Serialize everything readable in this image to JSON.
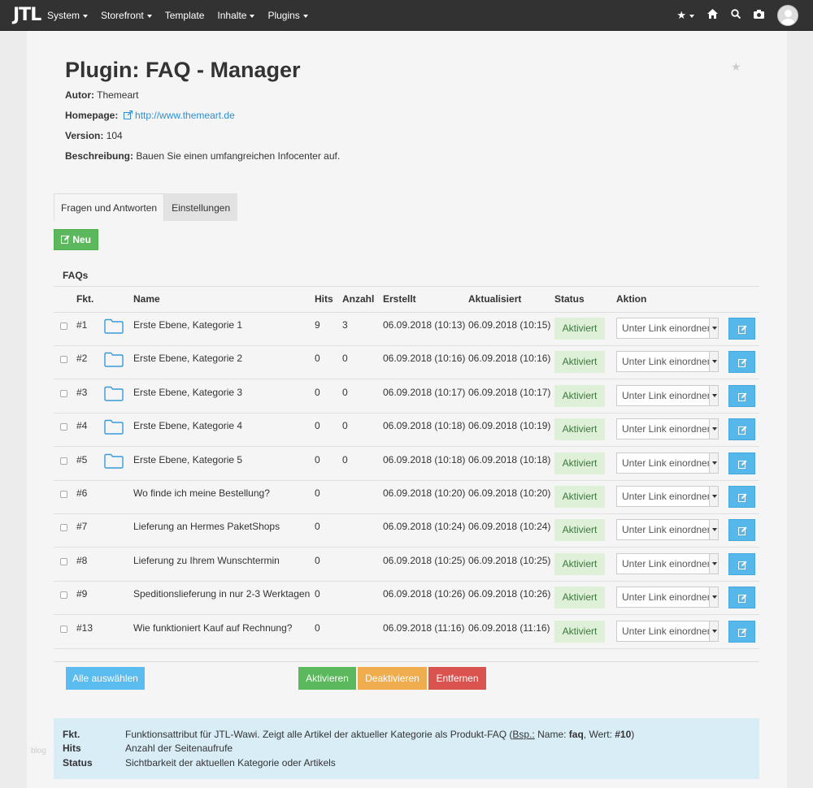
{
  "navbar": {
    "brand": "JTL",
    "items": [
      {
        "label": "System",
        "dropdown": true
      },
      {
        "label": "Storefront",
        "dropdown": true
      },
      {
        "label": "Template",
        "dropdown": false
      },
      {
        "label": "Inhalte",
        "dropdown": true
      },
      {
        "label": "Plugins",
        "dropdown": true
      }
    ],
    "right_icons": [
      "star-icon",
      "home-icon",
      "search-icon",
      "camera-icon",
      "avatar"
    ]
  },
  "header": {
    "title": "Plugin: FAQ - Manager",
    "author_label": "Autor:",
    "author": "Themeart",
    "homepage_label": "Homepage:",
    "homepage": "http://www.themeart.de",
    "version_label": "Version:",
    "version": "104",
    "description_label": "Beschreibung:",
    "description": "Bauen Sie einen umfangreichen Infocenter auf."
  },
  "tabs": [
    "Fragen und Antworten",
    "Einstellungen"
  ],
  "new_button": "Neu",
  "faqs_heading": "FAQs",
  "table": {
    "columns": [
      "Fkt.",
      "Name",
      "Hits",
      "Anzahl",
      "Erstellt",
      "Aktualisiert",
      "Status",
      "Aktion"
    ],
    "rows": [
      {
        "id": "#1",
        "folder": true,
        "name": "Erste Ebene, Kategorie 1",
        "hits": "9",
        "count": "3",
        "created": "06.09.2018 (10:13)",
        "updated": "06.09.2018 (10:15)",
        "status": "Aktiviert",
        "action": "Unter Link einordnen"
      },
      {
        "id": "#2",
        "folder": true,
        "name": "Erste Ebene, Kategorie 2",
        "hits": "0",
        "count": "0",
        "created": "06.09.2018 (10:16)",
        "updated": "06.09.2018 (10:16)",
        "status": "Aktiviert",
        "action": "Unter Link einordnen"
      },
      {
        "id": "#3",
        "folder": true,
        "name": "Erste Ebene, Kategorie 3",
        "hits": "0",
        "count": "0",
        "created": "06.09.2018 (10:17)",
        "updated": "06.09.2018 (10:17)",
        "status": "Aktiviert",
        "action": "Unter Link einordnen"
      },
      {
        "id": "#4",
        "folder": true,
        "name": "Erste Ebene, Kategorie 4",
        "hits": "0",
        "count": "0",
        "created": "06.09.2018 (10:18)",
        "updated": "06.09.2018 (10:19)",
        "status": "Aktiviert",
        "action": "Unter Link einordnen"
      },
      {
        "id": "#5",
        "folder": true,
        "name": "Erste Ebene, Kategorie 5",
        "hits": "0",
        "count": "0",
        "created": "06.09.2018 (10:18)",
        "updated": "06.09.2018 (10:18)",
        "status": "Aktiviert",
        "action": "Unter Link einordnen"
      },
      {
        "id": "#6",
        "folder": false,
        "name": "Wo finde ich meine Bestellung?",
        "hits": "0",
        "count": "",
        "created": "06.09.2018 (10:20)",
        "updated": "06.09.2018 (10:20)",
        "status": "Aktiviert",
        "action": "Unter Link einordnen"
      },
      {
        "id": "#7",
        "folder": false,
        "name": "Lieferung an Hermes PaketShops",
        "hits": "0",
        "count": "",
        "created": "06.09.2018 (10:24)",
        "updated": "06.09.2018 (10:24)",
        "status": "Aktiviert",
        "action": "Unter Link einordnen"
      },
      {
        "id": "#8",
        "folder": false,
        "name": "Lieferung zu Ihrem Wunschtermin",
        "hits": "0",
        "count": "",
        "created": "06.09.2018 (10:25)",
        "updated": "06.09.2018 (10:25)",
        "status": "Aktiviert",
        "action": "Unter Link einordnen"
      },
      {
        "id": "#9",
        "folder": false,
        "name": "Speditionslieferung in nur 2-3 Werktagen",
        "hits": "0",
        "count": "",
        "created": "06.09.2018 (10:26)",
        "updated": "06.09.2018 (10:26)",
        "status": "Aktiviert",
        "action": "Unter Link einordnen"
      },
      {
        "id": "#13",
        "folder": false,
        "name": "Wie funktioniert Kauf auf Rechnung?",
        "hits": "0",
        "count": "",
        "created": "06.09.2018 (11:16)",
        "updated": "06.09.2018 (11:16)",
        "status": "Aktiviert",
        "action": "Unter Link einordnen"
      }
    ]
  },
  "footer_buttons": {
    "select_all": "Alle auswählen",
    "activate": "Aktivieren",
    "deactivate": "Deaktivieren",
    "remove": "Entfernen"
  },
  "legend": {
    "fkt_term": "Fkt.",
    "fkt_def_a": "Funktionsattribut für JTL-Wawi. Zeigt alle Artikel der aktueller Kategorie als Produkt-FAQ (",
    "fkt_def_bsp": "Bsp.:",
    "fkt_def_b": " Name: ",
    "fkt_def_name": "faq",
    "fkt_def_c": ", Wert: ",
    "fkt_def_value": "#10",
    "fkt_def_d": ")",
    "hits_term": "Hits",
    "hits_def": "Anzahl der Seitenaufrufe",
    "status_term": "Status",
    "status_def": "Sichtbarkeit der aktuellen Kategorie oder Artikels"
  },
  "watermark": "blog",
  "colors": {
    "navbar": "#323232",
    "success": "#5cb85c",
    "warning": "#f0ad4e",
    "danger": "#d9534f",
    "info": "#56b8ea",
    "status_bg": "#dff0d8",
    "legend_bg": "#d9edf7",
    "link": "#2f8fcf"
  }
}
